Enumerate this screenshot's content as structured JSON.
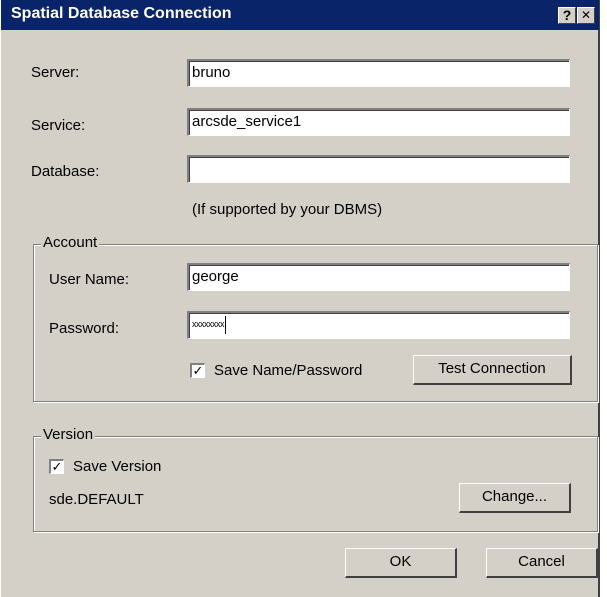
{
  "window": {
    "title": "Spatial Database Connection",
    "help_glyph": "?",
    "close_glyph": "✕"
  },
  "connection": {
    "server_label": "Server:",
    "server_value": "bruno",
    "service_label": "Service:",
    "service_value": "arcsde_service1",
    "database_label": "Database:",
    "database_value": "",
    "database_hint": "(If supported by your DBMS)"
  },
  "account": {
    "group_label": "Account",
    "username_label": "User Name:",
    "username_value": "george",
    "password_label": "Password:",
    "password_value": "xxxxxxxx",
    "save_checked_glyph": "✓",
    "save_label": "Save Name/Password",
    "test_button": "Test Connection"
  },
  "version": {
    "group_label": "Version",
    "save_checked_glyph": "✓",
    "save_label": "Save Version",
    "current_version": "sde.DEFAULT",
    "change_button": "Change..."
  },
  "footer": {
    "ok_button": "OK",
    "cancel_button": "Cancel"
  }
}
